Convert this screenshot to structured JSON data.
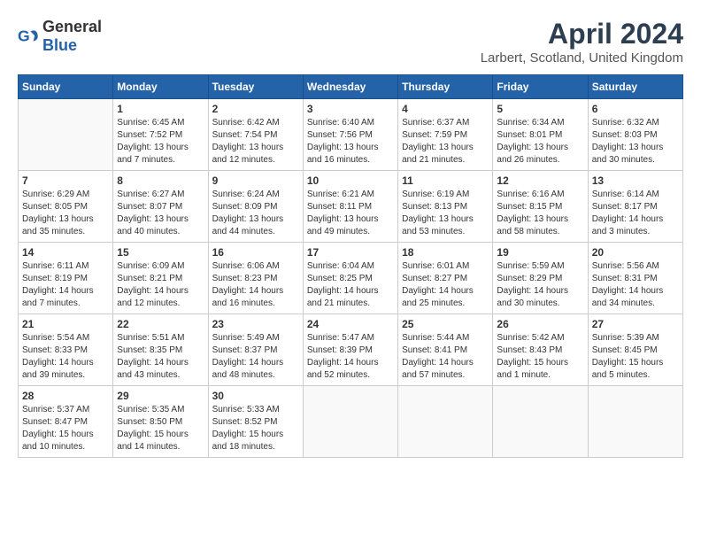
{
  "logo": {
    "general": "General",
    "blue": "Blue"
  },
  "title": "April 2024",
  "location": "Larbert, Scotland, United Kingdom",
  "days_header": [
    "Sunday",
    "Monday",
    "Tuesday",
    "Wednesday",
    "Thursday",
    "Friday",
    "Saturday"
  ],
  "weeks": [
    [
      {
        "day": "",
        "empty": true
      },
      {
        "day": "1",
        "sunrise": "6:45 AM",
        "sunset": "7:52 PM",
        "daylight": "13 hours and 7 minutes."
      },
      {
        "day": "2",
        "sunrise": "6:42 AM",
        "sunset": "7:54 PM",
        "daylight": "13 hours and 12 minutes."
      },
      {
        "day": "3",
        "sunrise": "6:40 AM",
        "sunset": "7:56 PM",
        "daylight": "13 hours and 16 minutes."
      },
      {
        "day": "4",
        "sunrise": "6:37 AM",
        "sunset": "7:59 PM",
        "daylight": "13 hours and 21 minutes."
      },
      {
        "day": "5",
        "sunrise": "6:34 AM",
        "sunset": "8:01 PM",
        "daylight": "13 hours and 26 minutes."
      },
      {
        "day": "6",
        "sunrise": "6:32 AM",
        "sunset": "8:03 PM",
        "daylight": "13 hours and 30 minutes."
      }
    ],
    [
      {
        "day": "7",
        "sunrise": "6:29 AM",
        "sunset": "8:05 PM",
        "daylight": "13 hours and 35 minutes."
      },
      {
        "day": "8",
        "sunrise": "6:27 AM",
        "sunset": "8:07 PM",
        "daylight": "13 hours and 40 minutes."
      },
      {
        "day": "9",
        "sunrise": "6:24 AM",
        "sunset": "8:09 PM",
        "daylight": "13 hours and 44 minutes."
      },
      {
        "day": "10",
        "sunrise": "6:21 AM",
        "sunset": "8:11 PM",
        "daylight": "13 hours and 49 minutes."
      },
      {
        "day": "11",
        "sunrise": "6:19 AM",
        "sunset": "8:13 PM",
        "daylight": "13 hours and 53 minutes."
      },
      {
        "day": "12",
        "sunrise": "6:16 AM",
        "sunset": "8:15 PM",
        "daylight": "13 hours and 58 minutes."
      },
      {
        "day": "13",
        "sunrise": "6:14 AM",
        "sunset": "8:17 PM",
        "daylight": "14 hours and 3 minutes."
      }
    ],
    [
      {
        "day": "14",
        "sunrise": "6:11 AM",
        "sunset": "8:19 PM",
        "daylight": "14 hours and 7 minutes."
      },
      {
        "day": "15",
        "sunrise": "6:09 AM",
        "sunset": "8:21 PM",
        "daylight": "14 hours and 12 minutes."
      },
      {
        "day": "16",
        "sunrise": "6:06 AM",
        "sunset": "8:23 PM",
        "daylight": "14 hours and 16 minutes."
      },
      {
        "day": "17",
        "sunrise": "6:04 AM",
        "sunset": "8:25 PM",
        "daylight": "14 hours and 21 minutes."
      },
      {
        "day": "18",
        "sunrise": "6:01 AM",
        "sunset": "8:27 PM",
        "daylight": "14 hours and 25 minutes."
      },
      {
        "day": "19",
        "sunrise": "5:59 AM",
        "sunset": "8:29 PM",
        "daylight": "14 hours and 30 minutes."
      },
      {
        "day": "20",
        "sunrise": "5:56 AM",
        "sunset": "8:31 PM",
        "daylight": "14 hours and 34 minutes."
      }
    ],
    [
      {
        "day": "21",
        "sunrise": "5:54 AM",
        "sunset": "8:33 PM",
        "daylight": "14 hours and 39 minutes."
      },
      {
        "day": "22",
        "sunrise": "5:51 AM",
        "sunset": "8:35 PM",
        "daylight": "14 hours and 43 minutes."
      },
      {
        "day": "23",
        "sunrise": "5:49 AM",
        "sunset": "8:37 PM",
        "daylight": "14 hours and 48 minutes."
      },
      {
        "day": "24",
        "sunrise": "5:47 AM",
        "sunset": "8:39 PM",
        "daylight": "14 hours and 52 minutes."
      },
      {
        "day": "25",
        "sunrise": "5:44 AM",
        "sunset": "8:41 PM",
        "daylight": "14 hours and 57 minutes."
      },
      {
        "day": "26",
        "sunrise": "5:42 AM",
        "sunset": "8:43 PM",
        "daylight": "15 hours and 1 minute."
      },
      {
        "day": "27",
        "sunrise": "5:39 AM",
        "sunset": "8:45 PM",
        "daylight": "15 hours and 5 minutes."
      }
    ],
    [
      {
        "day": "28",
        "sunrise": "5:37 AM",
        "sunset": "8:47 PM",
        "daylight": "15 hours and 10 minutes."
      },
      {
        "day": "29",
        "sunrise": "5:35 AM",
        "sunset": "8:50 PM",
        "daylight": "15 hours and 14 minutes."
      },
      {
        "day": "30",
        "sunrise": "5:33 AM",
        "sunset": "8:52 PM",
        "daylight": "15 hours and 18 minutes."
      },
      {
        "day": "",
        "empty": true
      },
      {
        "day": "",
        "empty": true
      },
      {
        "day": "",
        "empty": true
      },
      {
        "day": "",
        "empty": true
      }
    ]
  ],
  "labels": {
    "sunrise_prefix": "Sunrise: ",
    "sunset_prefix": "Sunset: ",
    "daylight_prefix": "Daylight: "
  }
}
